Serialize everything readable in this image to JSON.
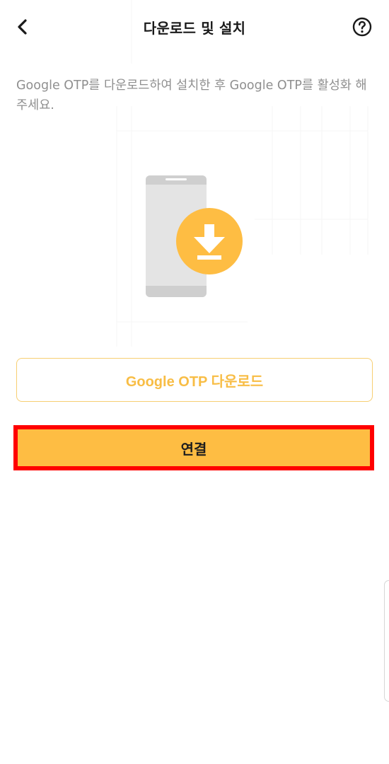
{
  "header": {
    "title": "다운로드 및 설치",
    "back_icon": "chevron-left-icon",
    "help_icon": "question-circle-icon"
  },
  "content": {
    "description": "Google OTP를 다운로드하여 설치한 후 Google OTP를 활성화 해 주세요.",
    "illustration": {
      "phone_icon": "smartphone-icon",
      "download_icon": "download-arrow-icon"
    }
  },
  "buttons": {
    "download_label": "Google OTP 다운로드",
    "connect_label": "연결"
  },
  "colors": {
    "accent": "#FEBD43",
    "accent_outline": "#F7CF72",
    "accent_text": "#F8BD45",
    "highlight_border": "#FF0000",
    "text_primary": "#1A1A1A",
    "text_secondary": "#8F8F8F"
  }
}
